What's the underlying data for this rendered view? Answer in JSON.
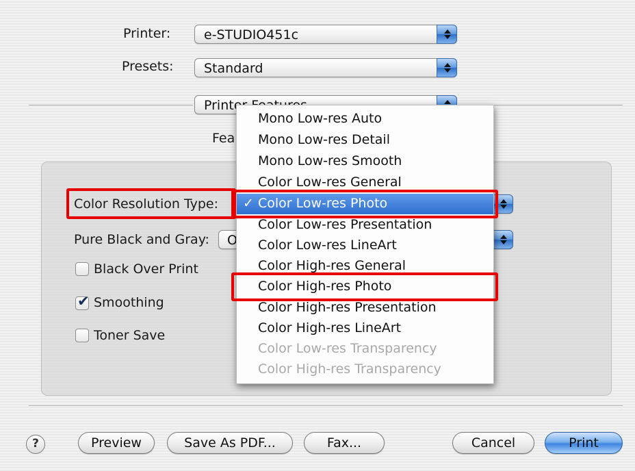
{
  "printer": {
    "label": "Printer:",
    "value": "e-STUDIO451c"
  },
  "presets": {
    "label": "Presets:",
    "value": "Standard"
  },
  "panel": {
    "value_partial": "Printer Features"
  },
  "feature_sets": {
    "label_partial": "Fea"
  },
  "color_resolution": {
    "label": "Color Resolution Type:"
  },
  "pure_black": {
    "label": "Pure Black and Gray:",
    "value_partial": "O"
  },
  "checkboxes": {
    "black_over_print": {
      "label": "Black Over Print",
      "checked": false
    },
    "smoothing": {
      "label": "Smoothing",
      "checked": true
    },
    "toner_save": {
      "label": "Toner Save",
      "checked": false
    }
  },
  "dropdown": {
    "check_glyph": "✓",
    "items": [
      {
        "label": "Mono Low-res Auto",
        "state": "normal"
      },
      {
        "label": "Mono Low-res Detail",
        "state": "normal"
      },
      {
        "label": "Mono Low-res Smooth",
        "state": "normal"
      },
      {
        "label": "Color Low-res General",
        "state": "normal"
      },
      {
        "label": "Color Low-res Photo",
        "state": "selected"
      },
      {
        "label": "Color Low-res Presentation",
        "state": "normal"
      },
      {
        "label": "Color Low-res LineArt",
        "state": "normal"
      },
      {
        "label": "Color High-res General",
        "state": "normal"
      },
      {
        "label": "Color High-res Photo",
        "state": "highlighted"
      },
      {
        "label": "Color High-res Presentation",
        "state": "normal"
      },
      {
        "label": "Color High-res LineArt",
        "state": "normal"
      },
      {
        "label": "Color Low-res Transparency",
        "state": "disabled"
      },
      {
        "label": "Color High-res Transparency",
        "state": "disabled"
      }
    ]
  },
  "buttons": {
    "help": "?",
    "preview": "Preview",
    "save_as_pdf": "Save As PDF...",
    "fax": "Fax...",
    "cancel": "Cancel",
    "print": "Print"
  },
  "colors": {
    "annotation_red": "#e60000",
    "selection_blue": "#2f6ed0"
  }
}
